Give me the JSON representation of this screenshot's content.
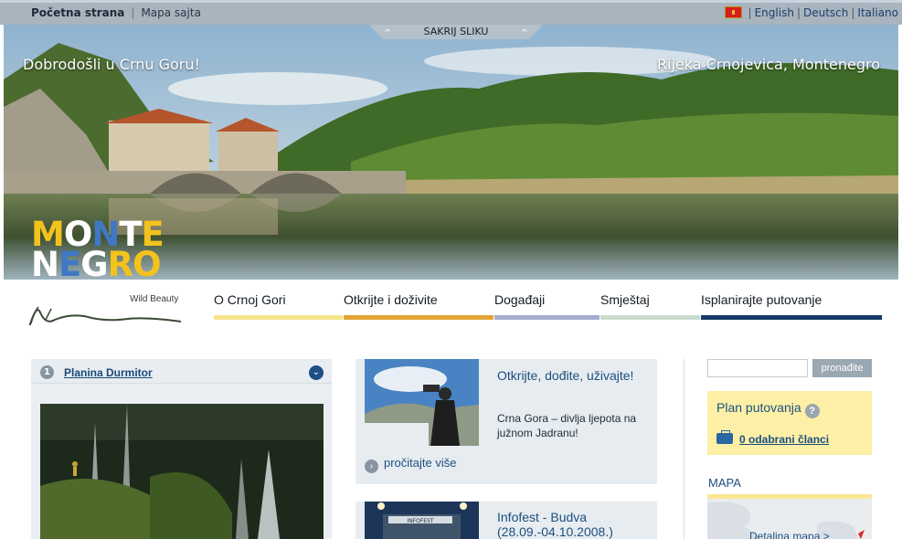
{
  "topbar": {
    "home": "Početna strana",
    "sep": "|",
    "sitemap": "Mapa sajta",
    "languages": [
      "English",
      "Deutsch",
      "Italiano"
    ]
  },
  "hero": {
    "hide_label": "SAKRIJ SLIKU",
    "hide_caret": "^",
    "welcome": "Dobrodošli u Crnu Goru!",
    "place": "Rijeka Crnojevica, Montenegro",
    "logo_line1": [
      "M",
      "O",
      "N",
      "T",
      "E"
    ],
    "logo_line2": [
      "N",
      "E",
      "G",
      "R",
      "O"
    ],
    "logo_colors": [
      "#f4c21d",
      "#ffffff",
      "#3f78c4",
      "#ffffff",
      "#f4c21d"
    ]
  },
  "wild_beauty": "Wild Beauty",
  "nav": [
    {
      "label": "O Crnoj Gori",
      "color": "#f6e58a"
    },
    {
      "label": "Otkrijte i doživite",
      "color": "#e0a533"
    },
    {
      "label": "Događaji",
      "color": "#a7acd1"
    },
    {
      "label": "Smještaj",
      "color": "#c9dccd"
    },
    {
      "label": "Isplanirajte putovanje",
      "color": "#16386a"
    }
  ],
  "feature": {
    "number": "1",
    "title": "Planina Durmitor",
    "chevron": "⌄"
  },
  "cards": [
    {
      "heading": "Otkrijte, dođite, uživajte!",
      "text": "Crna Gora – divlja ljepota na južnom Jadranu!",
      "more": "pročitajte više",
      "more_icon": "›"
    },
    {
      "heading": "Infofest - Budva (28.09.-04.10.2008.)",
      "sign": "INFOFEST"
    }
  ],
  "search": {
    "placeholder": "",
    "button": "pronađite"
  },
  "plan": {
    "title": "Plan putovanja",
    "help": "?",
    "count": "0 odabrani članci"
  },
  "map": {
    "title": "MAPA",
    "link": "Detaljna mapa >"
  }
}
